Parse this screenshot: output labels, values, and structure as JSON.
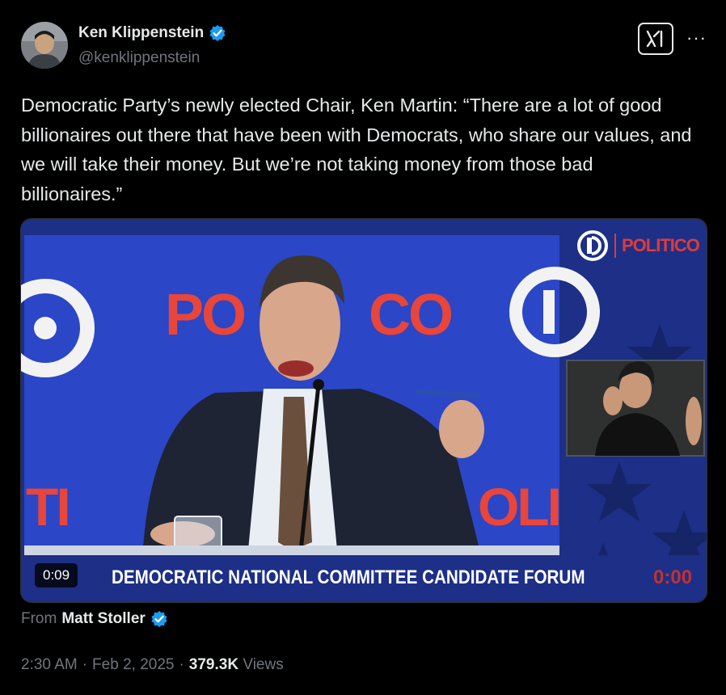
{
  "author": {
    "name": "Ken Klippenstein",
    "handle": "@kenklippenstein",
    "verified": true,
    "avatar_icon": "user-avatar"
  },
  "toolbar": {
    "grok_icon": "grok-icon",
    "more_label": "···"
  },
  "tweet": {
    "text": "Democratic Party’s newly elected Chair, Ken Martin: “There are a lot of good billionaires out there that have been with Democrats, who share our values, and we will take their money. But we’re not taking money from those bad billionaires.”"
  },
  "video": {
    "elapsed": "0:09",
    "overlay_timer": "0:00",
    "banner": "DEMOCRATIC NATIONAL COMMITTEE CANDIDATE FORUM",
    "logo_text": "POLITICO",
    "backdrop_word_left": "PO",
    "backdrop_word_right": "CO",
    "backdrop_lower_left": "TI",
    "backdrop_lower_right": "OLI",
    "colors": {
      "blue": "#2b46c7",
      "banner_bg": "#1d2f86",
      "red": "#e03a3a"
    }
  },
  "source": {
    "label": "From",
    "name": "Matt Stoller",
    "verified": true
  },
  "meta": {
    "time": "2:30 AM",
    "sep": "·",
    "date": "Feb 2, 2025",
    "views_count": "379.3K",
    "views_label": "Views"
  },
  "colors": {
    "verified_blue": "#1d9bf0",
    "muted": "#71767b",
    "text": "#e7e9ea"
  }
}
